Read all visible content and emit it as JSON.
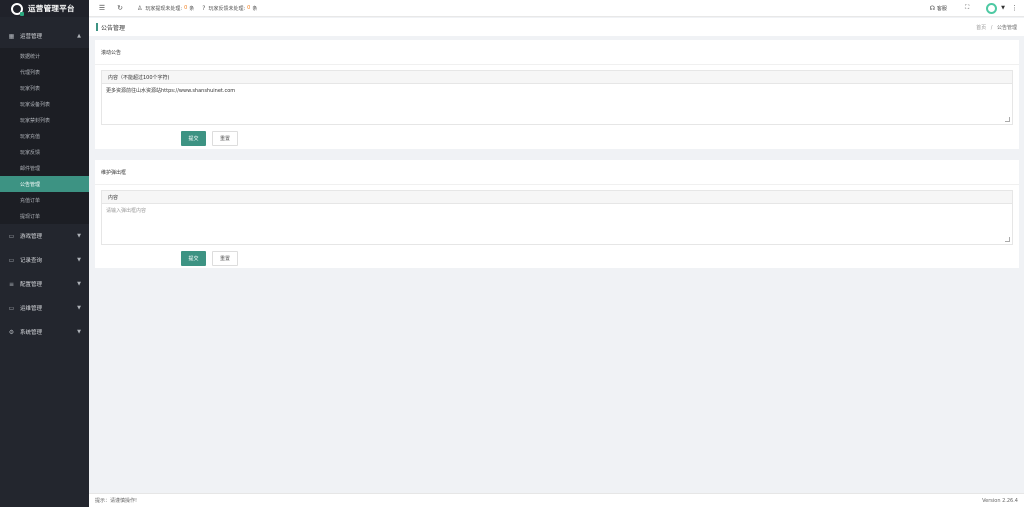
{
  "app": {
    "title": "运营管理平台"
  },
  "sidebar": {
    "groups": [
      {
        "label": "运营管理",
        "icon": "chart-icon",
        "expanded": true,
        "items": [
          "数据统计",
          "代理列表",
          "玩家列表",
          "玩家设备列表",
          "玩家禁封列表",
          "玩家充值",
          "玩家反馈",
          "邮件管理",
          "公告管理",
          "充值订单",
          "提现订单"
        ],
        "active": "公告管理"
      },
      {
        "label": "游戏管理",
        "icon": "book-icon"
      },
      {
        "label": "记录查询",
        "icon": "book-icon"
      },
      {
        "label": "配置管理",
        "icon": "list-icon"
      },
      {
        "label": "运维管理",
        "icon": "book-icon"
      },
      {
        "label": "系统管理",
        "icon": "gear-icon"
      }
    ]
  },
  "topbar": {
    "stat1_label": "玩家提现未处理:",
    "stat1_value": "0",
    "stat1_unit": "条",
    "stat2_label": "玩家反馈未处理:",
    "stat2_value": "0",
    "stat2_unit": "条",
    "kefu_label": "客服"
  },
  "page": {
    "title": "公告管理",
    "breadcrumb_home": "首页",
    "breadcrumb_sep": "/",
    "breadcrumb_current": "公告管理"
  },
  "scroll_notice": {
    "title": "滚动公告",
    "field_label": "内容（不能超过100个字符)",
    "value": "更多资源前往山水资源站https://www.shanshuinet.com",
    "submit_label": "提交",
    "reset_label": "重置"
  },
  "popup_notice": {
    "title": "维护弹出框",
    "field_label": "内容",
    "placeholder": "请输入弹出框内容",
    "submit_label": "提交",
    "reset_label": "重置"
  },
  "footer": {
    "hint": "提示：请谨慎操作!",
    "version": "Version 2.26.4"
  },
  "colors": {
    "accent": "#3d9383",
    "sidebar_bg": "#23262e",
    "number": "#f27b17"
  }
}
